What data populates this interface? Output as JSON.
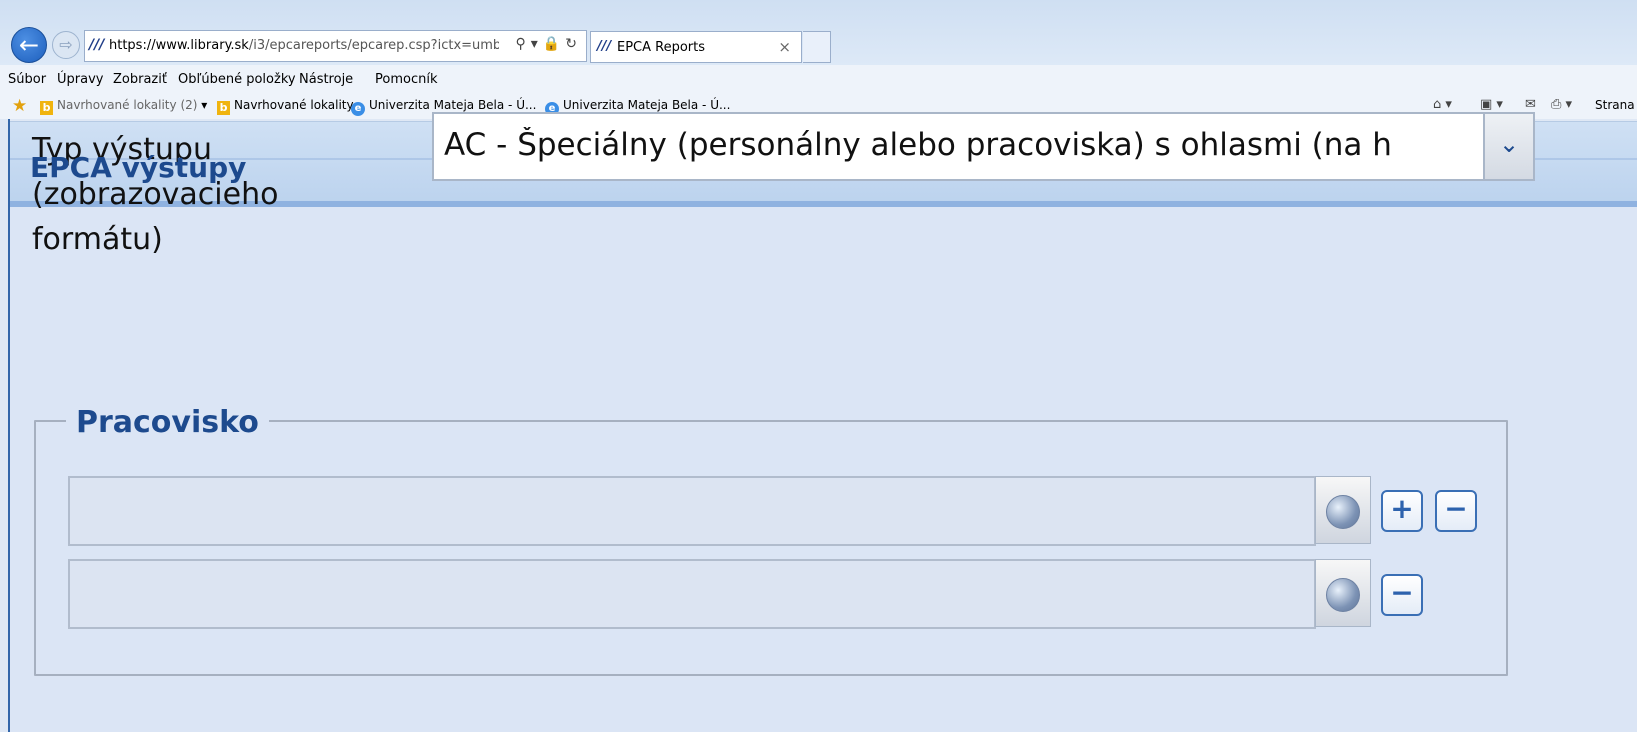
{
  "browser": {
    "url_host": "https://www.library.sk",
    "url_path": "/i3/epcareports/epcarep.csp?ictx=umb&langua",
    "tab_title": "EPCA Reports"
  },
  "menu": [
    "Súbor",
    "Úpravy",
    "Zobraziť",
    "Obľúbené položky",
    "Nástroje",
    "Pomocník"
  ],
  "favorites": {
    "item1": "Navrhované lokality",
    "item1_count": "(2)",
    "item2": "Navrhované lokality",
    "item3": "Univerzita Mateja Bela - Ú...",
    "item4": "Univerzita Mateja Bela - Ú..."
  },
  "command_bar": {
    "page_label": "Strana"
  },
  "page": {
    "title": "EPCA výstupy",
    "output_type_label": "Typ výstupu (zobrazovacieho formátu)",
    "output_type_value": "AC - Špeciálny (personálny alebo pracoviska) s ohlasmi (na h",
    "workplace_legend": "Pracovisko",
    "plus_symbol": "+",
    "minus_symbol": "−"
  }
}
